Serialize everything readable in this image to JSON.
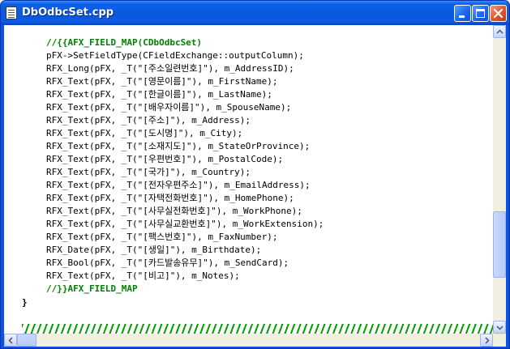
{
  "window": {
    "title": "DbOdbcSet.cpp"
  },
  "icons": {
    "app": "document-icon",
    "minimize": "minimize-icon",
    "maximize": "maximize-icon",
    "close": "close-icon"
  },
  "code_lines": [
    "//{{AFX_FIELD_MAP(CDbOdbcSet)",
    "pFX->SetFieldType(CFieldExchange::outputColumn);",
    "RFX_Long(pFX, _T(\"[주소일련번호]\"), m_AddressID);",
    "RFX_Text(pFX, _T(\"[영문이름]\"), m_FirstName);",
    "RFX_Text(pFX, _T(\"[한글이름]\"), m_LastName);",
    "RFX_Text(pFX, _T(\"[배우자이름]\"), m_SpouseName);",
    "RFX_Text(pFX, _T(\"[주소]\"), m_Address);",
    "RFX_Text(pFX, _T(\"[도시명]\"), m_City);",
    "RFX_Text(pFX, _T(\"[소재지도]\"), m_StateOrProvince);",
    "RFX_Text(pFX, _T(\"[우편번호]\"), m_PostalCode);",
    "RFX_Text(pFX, _T(\"[국가]\"), m_Country);",
    "RFX_Text(pFX, _T(\"[전자우편주소]\"), m_EmailAddress);",
    "RFX_Text(pFX, _T(\"[자택전화번호]\"), m_HomePhone);",
    "RFX_Text(pFX, _T(\"[사무실전화번호]\"), m_WorkPhone);",
    "RFX_Text(pFX, _T(\"[사무실교환번호]\"), m_WorkExtension);",
    "RFX_Text(pFX, _T(\"[팩스번호]\"), m_FaxNumber);",
    "RFX_Date(pFX, _T(\"[생일]\"), m_Birthdate);",
    "RFX_Bool(pFX, _T(\"[카드발송유무]\"), m_SendCard);",
    "RFX_Text(pFX, _T(\"[비고]\"), m_Notes);",
    "//}}AFX_FIELD_MAP",
    "}"
  ],
  "colors": {
    "comment": "#008000",
    "text": "#000000",
    "titlebar": "#0a5ae6"
  }
}
